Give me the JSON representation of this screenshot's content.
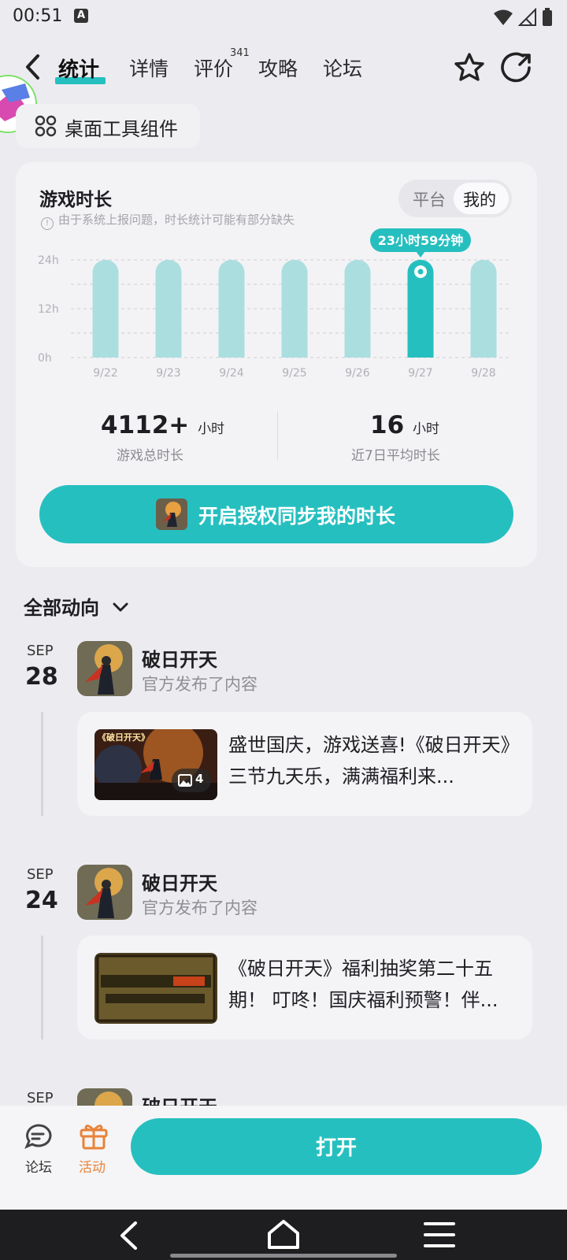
{
  "status": {
    "time": "00:51",
    "notif_icon": "A"
  },
  "nav": {
    "tabs": [
      {
        "label": "统计"
      },
      {
        "label": "详情"
      },
      {
        "label": "评价"
      },
      {
        "label": "攻略"
      },
      {
        "label": "论坛"
      }
    ],
    "review_count": "341"
  },
  "widget_chip": {
    "label": "桌面工具组件"
  },
  "playtime": {
    "title": "游戏时长",
    "note": "由于系统上报问题，时长统计可能有部分缺失",
    "segment": {
      "platform": "平台",
      "mine": "我的"
    },
    "tooltip": "23小时59分钟",
    "total": {
      "value": "4112+",
      "unit": "小时",
      "label": "游戏总时长"
    },
    "avg": {
      "value": "16",
      "unit": "小时",
      "label": "近7日平均时长"
    },
    "sync_label": "开启授权同步我的时长"
  },
  "chart_data": {
    "type": "bar",
    "categories": [
      "9/22",
      "9/23",
      "9/24",
      "9/25",
      "9/26",
      "9/27",
      "9/28"
    ],
    "values": [
      24,
      24,
      24,
      24,
      24,
      24,
      24
    ],
    "highlighted": "9/27",
    "yticks": [
      "24h",
      "12h",
      "0h"
    ],
    "ylim": [
      0,
      24
    ],
    "colors": {
      "bar": "#abdedf",
      "highlight": "#26bfbf"
    }
  },
  "feed": {
    "filter_label": "全部动向",
    "items": [
      {
        "month": "SEP",
        "day": "28",
        "name": "破日开天",
        "sub": "官方发布了内容",
        "text": "盛世国庆，游戏送喜!《破日开天》三节九天乐，满满福利来...",
        "img_title": "《破日开天》",
        "img_count": "4"
      },
      {
        "month": "SEP",
        "day": "24",
        "name": "破日开天",
        "sub": "官方发布了内容",
        "text": "《破日开天》福利抽奖第二十五期！ 叮咚！国庆福利预警！伴..."
      },
      {
        "month": "SEP",
        "day": "",
        "name": "破日开天",
        "sub": ""
      }
    ]
  },
  "bottom": {
    "forum_label": "论坛",
    "activity_label": "活动",
    "open_label": "打开"
  },
  "colors": {
    "accent": "#26bfbf",
    "activity": "#e8833a"
  }
}
